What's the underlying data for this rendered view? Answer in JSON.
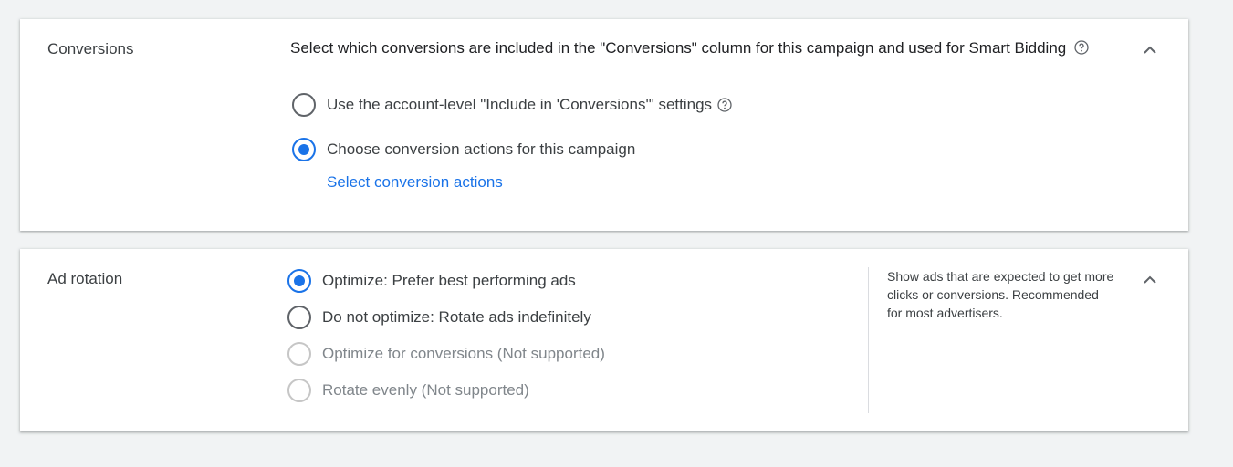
{
  "conversions": {
    "title": "Conversions",
    "description": "Select which conversions are included in the \"Conversions\" column for this campaign and used for Smart Bidding",
    "options": [
      {
        "label": "Use the account-level \"Include in 'Conversions'\" settings",
        "checked": false
      },
      {
        "label": "Choose conversion actions for this campaign",
        "checked": true
      }
    ],
    "link_label": "Select conversion actions"
  },
  "ad_rotation": {
    "title": "Ad rotation",
    "options": [
      {
        "label": "Optimize: Prefer best performing ads",
        "checked": true,
        "disabled": false
      },
      {
        "label": "Do not optimize: Rotate ads indefinitely",
        "checked": false,
        "disabled": false
      },
      {
        "label": "Optimize for conversions (Not supported)",
        "checked": false,
        "disabled": true
      },
      {
        "label": "Rotate evenly (Not supported)",
        "checked": false,
        "disabled": true
      }
    ],
    "help_text": "Show ads that are expected to get more clicks or conversions. Recommended for most advertisers."
  },
  "icons": {
    "help": "help-circle-icon",
    "collapse": "chevron-up-icon"
  },
  "colors": {
    "accent": "#1a73e8",
    "text": "#202124",
    "muted": "#80868b",
    "background": "#f1f3f4"
  }
}
